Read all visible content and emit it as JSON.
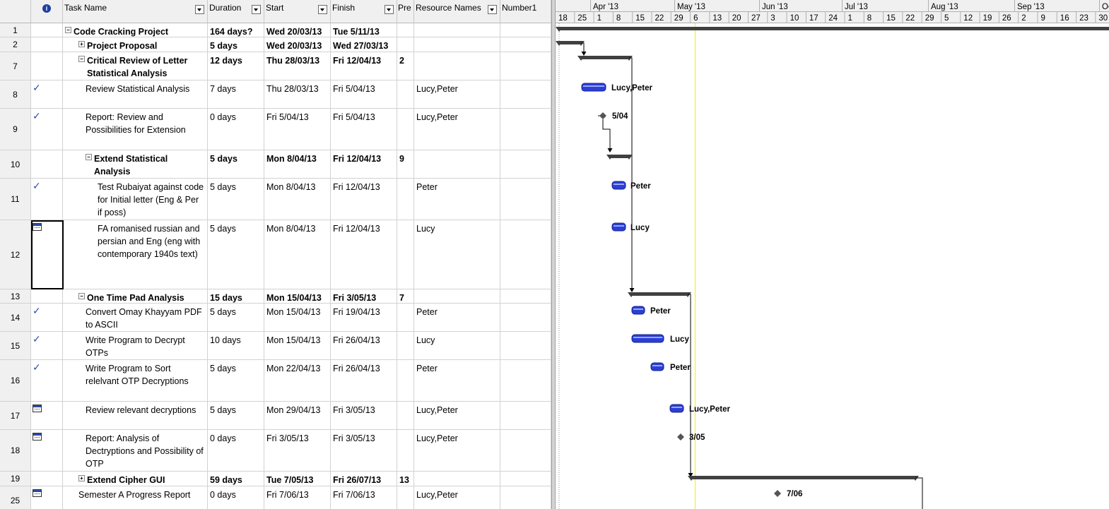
{
  "columns": {
    "info": "i",
    "task_name": "Task Name",
    "duration": "Duration",
    "start": "Start",
    "finish": "Finish",
    "predecessors": "Pre",
    "resource_names": "Resource Names",
    "number1": "Number1"
  },
  "rows": [
    {
      "id": "1",
      "ind": "",
      "name": "Code Cracking Project",
      "dur": "164 days?",
      "start": "Wed 20/03/13",
      "finish": "Tue 5/11/13",
      "pred": "",
      "res": "",
      "bold": true,
      "level": 0,
      "toggle": "−"
    },
    {
      "id": "2",
      "ind": "",
      "name": "Project Proposal",
      "dur": "5 days",
      "start": "Wed 20/03/13",
      "finish": "Wed 27/03/13",
      "pred": "",
      "res": "",
      "bold": true,
      "level": 1,
      "toggle": "+"
    },
    {
      "id": "7",
      "ind": "",
      "name": "Critical Review of Letter Statistical Analysis",
      "dur": "12 days",
      "start": "Thu 28/03/13",
      "finish": "Fri 12/04/13",
      "pred": "2",
      "res": "",
      "bold": true,
      "level": 1,
      "toggle": "−"
    },
    {
      "id": "8",
      "ind": "check",
      "name": "Review Statistical Analysis",
      "dur": "7 days",
      "start": "Thu 28/03/13",
      "finish": "Fri 5/04/13",
      "pred": "",
      "res": "Lucy,Peter",
      "bold": false,
      "level": 2,
      "toggle": ""
    },
    {
      "id": "9",
      "ind": "check",
      "name": "Report: Review and Possibilities for Extension",
      "dur": "0 days",
      "start": "Fri 5/04/13",
      "finish": "Fri 5/04/13",
      "pred": "",
      "res": "Lucy,Peter",
      "bold": false,
      "level": 2,
      "toggle": ""
    },
    {
      "id": "10",
      "ind": "",
      "name": "Extend Statistical Analysis",
      "dur": "5 days",
      "start": "Mon 8/04/13",
      "finish": "Fri 12/04/13",
      "pred": "9",
      "res": "",
      "bold": true,
      "level": 2,
      "toggle": "−"
    },
    {
      "id": "11",
      "ind": "check",
      "name": "Test Rubaiyat against code for Initial letter (Eng & Per if poss)",
      "dur": "5 days",
      "start": "Mon 8/04/13",
      "finish": "Fri 12/04/13",
      "pred": "",
      "res": "Peter",
      "bold": false,
      "level": 3,
      "toggle": ""
    },
    {
      "id": "12",
      "ind": "cal",
      "name": "FA romanised russian and persian and Eng (eng with contemporary 1940s text)",
      "dur": "5 days",
      "start": "Mon 8/04/13",
      "finish": "Fri 12/04/13",
      "pred": "",
      "res": "Lucy",
      "bold": false,
      "level": 3,
      "toggle": ""
    },
    {
      "id": "13",
      "ind": "",
      "name": "One Time Pad Analysis",
      "dur": "15 days",
      "start": "Mon 15/04/13",
      "finish": "Fri 3/05/13",
      "pred": "7",
      "res": "",
      "bold": true,
      "level": 1,
      "toggle": "−"
    },
    {
      "id": "14",
      "ind": "check",
      "name": "Convert Omay Khayyam PDF to ASCII",
      "dur": "5 days",
      "start": "Mon 15/04/13",
      "finish": "Fri 19/04/13",
      "pred": "",
      "res": "Peter",
      "bold": false,
      "level": 2,
      "toggle": ""
    },
    {
      "id": "15",
      "ind": "check",
      "name": "Write Program to Decrypt OTPs",
      "dur": "10 days",
      "start": "Mon 15/04/13",
      "finish": "Fri 26/04/13",
      "pred": "",
      "res": "Lucy",
      "bold": false,
      "level": 2,
      "toggle": ""
    },
    {
      "id": "16",
      "ind": "check",
      "name": "Write Program to Sort relelvant OTP Decryptions",
      "dur": "5 days",
      "start": "Mon 22/04/13",
      "finish": "Fri 26/04/13",
      "pred": "",
      "res": "Peter",
      "bold": false,
      "level": 2,
      "toggle": ""
    },
    {
      "id": "17",
      "ind": "cal",
      "name": "Review relevant decryptions",
      "dur": "5 days",
      "start": "Mon 29/04/13",
      "finish": "Fri 3/05/13",
      "pred": "",
      "res": "Lucy,Peter",
      "bold": false,
      "level": 2,
      "toggle": ""
    },
    {
      "id": "18",
      "ind": "cal",
      "name": "Report: Analysis of Dectryptions and Possibility of OTP",
      "dur": "0 days",
      "start": "Fri 3/05/13",
      "finish": "Fri 3/05/13",
      "pred": "",
      "res": "Lucy,Peter",
      "bold": false,
      "level": 2,
      "toggle": ""
    },
    {
      "id": "19",
      "ind": "",
      "name": "Extend Cipher GUI",
      "dur": "59 days",
      "start": "Tue 7/05/13",
      "finish": "Fri 26/07/13",
      "pred": "13",
      "res": "",
      "bold": true,
      "level": 1,
      "toggle": "+"
    },
    {
      "id": "25",
      "ind": "cal",
      "name": "Semester A Progress Report",
      "dur": "0 days",
      "start": "Fri 7/06/13",
      "finish": "Fri 7/06/13",
      "pred": "",
      "res": "Lucy,Peter",
      "bold": false,
      "level": 1,
      "toggle": ""
    }
  ],
  "timescale": {
    "months": [
      "Apr '13",
      "May '13",
      "Jun '13",
      "Jul '13",
      "Aug '13",
      "Sep '13",
      "Oc"
    ],
    "days": [
      "18",
      "25",
      "1",
      "8",
      "15",
      "22",
      "29",
      "6",
      "13",
      "20",
      "27",
      "3",
      "10",
      "17",
      "24",
      "1",
      "8",
      "15",
      "22",
      "29",
      "5",
      "12",
      "19",
      "26",
      "2",
      "9",
      "16",
      "23",
      "30"
    ]
  },
  "gantt_labels": {
    "r8": "Lucy,Peter",
    "r9": "5/04",
    "r11": "Peter",
    "r12": "Lucy",
    "r14": "Peter",
    "r15": "Lucy",
    "r16": "Peter",
    "r17": "Lucy,Peter",
    "r18": "3/05",
    "r25": "7/06"
  },
  "colors": {
    "task_bar": "#2b3fd6",
    "summary_bar": "#404040",
    "status_date_line": "#f2f200",
    "header_bg": "#f0f0f0",
    "grid_line": "#d2d2d2"
  }
}
